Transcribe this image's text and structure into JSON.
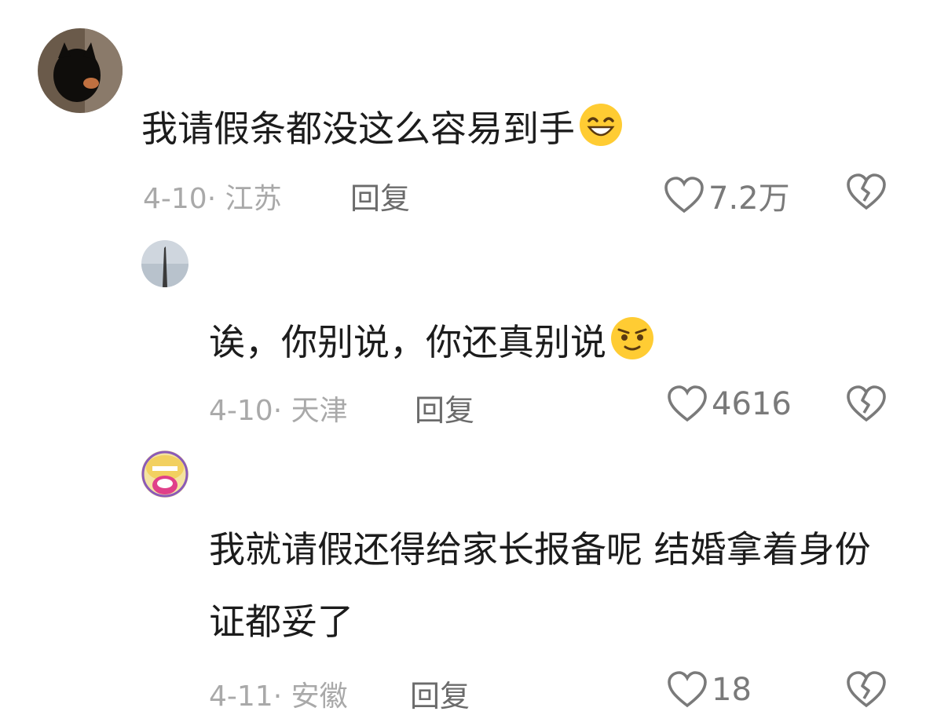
{
  "comments": [
    {
      "text": "我请假条都没这么容易到手",
      "emoji": "grinning-sweat-emoji",
      "date": "4-10",
      "location": "江苏",
      "reply_label": "回复",
      "likes": "7.2万"
    },
    {
      "text": "诶，你别说，你还真别说",
      "emoji": "smug-face-emoji",
      "date": "4-10",
      "location": "天津",
      "reply_label": "回复",
      "likes": "4616"
    },
    {
      "text": "我就请假还得给家长报备呢 结婚拿着身份证都妥了",
      "date": "4-11",
      "location": "安徽",
      "reply_label": "回复",
      "likes": "18"
    }
  ],
  "meta_separator": "·",
  "colors": {
    "text": "#1c1c1c",
    "meta": "#a9a9a9",
    "reply": "#6b6b6b",
    "icon": "#7a7a7a"
  }
}
